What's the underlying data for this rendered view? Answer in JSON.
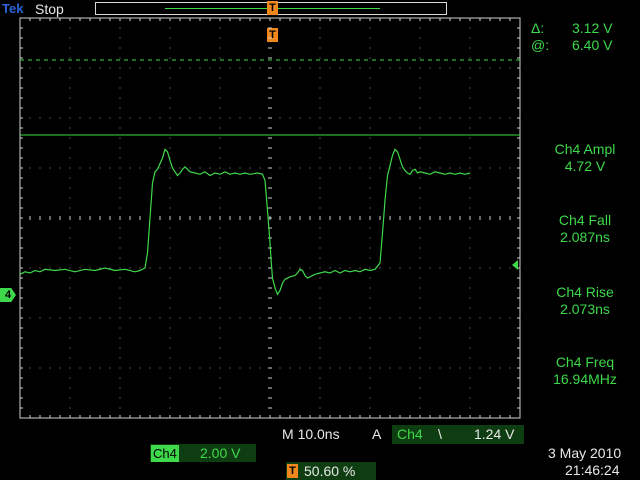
{
  "header": {
    "logo": "Tek",
    "run_state": "Stop",
    "trigger_marker_glyph": "T"
  },
  "cursors": {
    "delta_symbol": "Δ:",
    "delta_value": "3.12 V",
    "at_symbol": "@:",
    "at_value": "6.40 V"
  },
  "measurements": [
    {
      "label": "Ch4 Ampl",
      "value": "4.72 V"
    },
    {
      "label": "Ch4 Fall",
      "value": "2.087ns"
    },
    {
      "label": "Ch4 Rise",
      "value": "2.073ns"
    },
    {
      "label": "Ch4 Freq",
      "value": "16.94MHz"
    }
  ],
  "channel_marker": "4",
  "timebase": {
    "prefix": "M",
    "value": "10.0ns",
    "trigger_prefix": "A",
    "trigger_channel": "Ch4",
    "trigger_slope": "\\",
    "trigger_level": "1.24 V"
  },
  "vertical": {
    "channel": "Ch4",
    "scale": "2.00 V"
  },
  "trigger_position": {
    "glyph": "T",
    "value": "50.60 %"
  },
  "datetime": {
    "date": "3 May 2010",
    "time": "21:46:24"
  },
  "colors": {
    "trace": "#3ed94a",
    "graticule": "#d0d0d0",
    "background": "#000000",
    "trigger_orange": "#f0881d",
    "logo_blue": "#2a63d8"
  },
  "waveform": [
    [
      0,
      -2.05
    ],
    [
      2,
      -1.95
    ],
    [
      4,
      -2.0
    ],
    [
      6,
      -1.9
    ],
    [
      8,
      -1.95
    ],
    [
      10,
      -1.85
    ],
    [
      14,
      -1.9
    ],
    [
      18,
      -1.85
    ],
    [
      22,
      -1.95
    ],
    [
      26,
      -1.85
    ],
    [
      30,
      -1.9
    ],
    [
      34,
      -1.8
    ],
    [
      38,
      -1.9
    ],
    [
      42,
      -1.85
    ],
    [
      46,
      -1.95
    ],
    [
      48,
      -1.9
    ],
    [
      50,
      -1.8
    ],
    [
      51,
      -1.2
    ],
    [
      52,
      0.2
    ],
    [
      53,
      1.6
    ],
    [
      54,
      2.05
    ],
    [
      55,
      2.15
    ],
    [
      57,
      2.6
    ],
    [
      58,
      2.95
    ],
    [
      59,
      2.85
    ],
    [
      60,
      2.5
    ],
    [
      61,
      2.2
    ],
    [
      62,
      2.05
    ],
    [
      63,
      1.9
    ],
    [
      64,
      2.0
    ],
    [
      65,
      2.15
    ],
    [
      66,
      2.25
    ],
    [
      67,
      2.15
    ],
    [
      68,
      2.05
    ],
    [
      70,
      2.0
    ],
    [
      72,
      1.95
    ],
    [
      74,
      2.05
    ],
    [
      76,
      1.9
    ],
    [
      78,
      2.0
    ],
    [
      80,
      1.95
    ],
    [
      82,
      2.05
    ],
    [
      84,
      1.95
    ],
    [
      86,
      2.0
    ],
    [
      88,
      1.95
    ],
    [
      90,
      2.0
    ],
    [
      92,
      1.95
    ],
    [
      95,
      2.0
    ],
    [
      97,
      1.95
    ],
    [
      98,
      1.7
    ],
    [
      99,
      0.5
    ],
    [
      100,
      -0.8
    ],
    [
      100.5,
      -1.6
    ],
    [
      101,
      -2.2
    ],
    [
      102,
      -2.6
    ],
    [
      103,
      -2.85
    ],
    [
      104,
      -2.7
    ],
    [
      105,
      -2.4
    ],
    [
      106,
      -2.25
    ],
    [
      108,
      -2.15
    ],
    [
      110,
      -2.1
    ],
    [
      111,
      -2.0
    ],
    [
      112,
      -1.85
    ],
    [
      113,
      -1.9
    ],
    [
      114,
      -2.1
    ],
    [
      115,
      -2.2
    ],
    [
      116,
      -2.15
    ],
    [
      118,
      -2.05
    ],
    [
      120,
      -2.0
    ],
    [
      122,
      -1.95
    ],
    [
      124,
      -2.0
    ],
    [
      126,
      -1.9
    ],
    [
      128,
      -2.0
    ],
    [
      130,
      -1.9
    ],
    [
      132,
      -1.95
    ],
    [
      134,
      -1.9
    ],
    [
      136,
      -1.95
    ],
    [
      138,
      -1.85
    ],
    [
      140,
      -1.9
    ],
    [
      142,
      -1.85
    ],
    [
      144,
      -1.6
    ],
    [
      145,
      -0.4
    ],
    [
      146,
      0.9
    ],
    [
      147,
      1.9
    ],
    [
      148,
      2.3
    ],
    [
      149,
      2.7
    ],
    [
      150,
      2.95
    ],
    [
      151,
      2.85
    ],
    [
      152,
      2.55
    ],
    [
      153,
      2.25
    ],
    [
      154,
      2.1
    ],
    [
      155,
      2.0
    ],
    [
      156,
      1.95
    ],
    [
      157,
      2.1
    ],
    [
      158,
      2.15
    ],
    [
      159,
      2.0
    ],
    [
      160,
      2.05
    ],
    [
      162,
      2.0
    ],
    [
      164,
      1.95
    ],
    [
      166,
      2.05
    ],
    [
      168,
      2.0
    ],
    [
      170,
      1.95
    ],
    [
      172,
      2.0
    ],
    [
      174,
      1.95
    ],
    [
      176,
      2.0
    ],
    [
      178,
      1.95
    ],
    [
      180,
      2.0
    ]
  ]
}
